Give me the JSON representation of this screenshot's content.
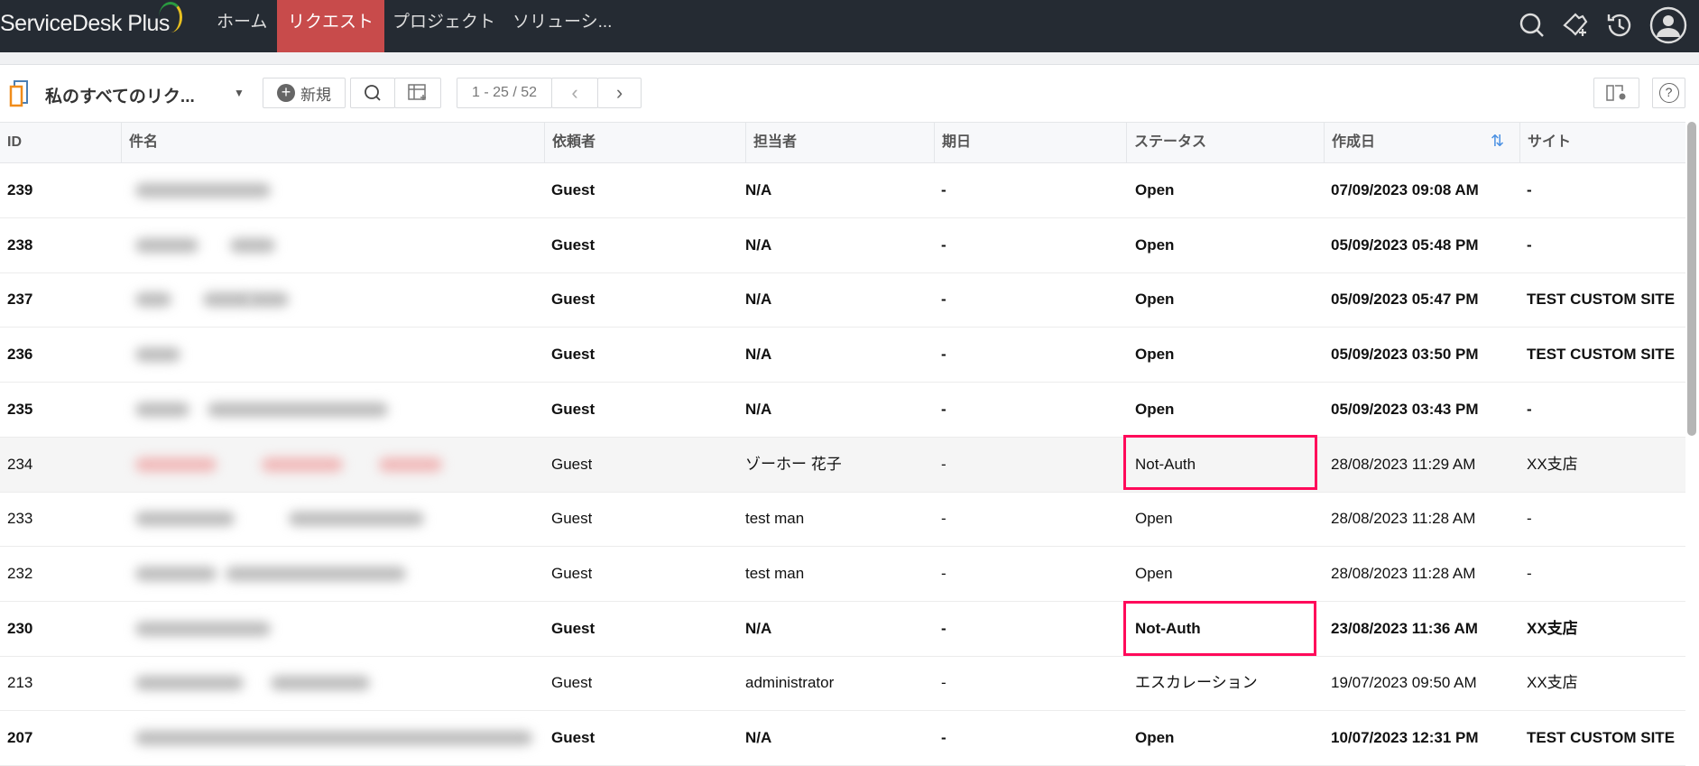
{
  "app": {
    "logo": "ServiceDesk Plus"
  },
  "nav": [
    {
      "label": "ホーム"
    },
    {
      "label": "リクエスト",
      "active": true
    },
    {
      "label": "プロジェクト"
    },
    {
      "label": "ソリューシ..."
    }
  ],
  "toolbar": {
    "view_name": "私のすべてのリク...",
    "new_label": "新規",
    "pagination": "1 - 25 / 52"
  },
  "columns": [
    "ID",
    "件名",
    "依頼者",
    "担当者",
    "期日",
    "ステータス",
    "作成日",
    "サイト"
  ],
  "rows": [
    {
      "id": "239",
      "requester": "Guest",
      "tech": "N/A",
      "due": "-",
      "status": "Open",
      "created": "07/09/2023 09:08 AM",
      "site": "-",
      "bold": true
    },
    {
      "id": "238",
      "requester": "Guest",
      "tech": "N/A",
      "due": "-",
      "status": "Open",
      "created": "05/09/2023 05:48 PM",
      "site": "-",
      "bold": true
    },
    {
      "id": "237",
      "requester": "Guest",
      "tech": "N/A",
      "due": "-",
      "status": "Open",
      "created": "05/09/2023 05:47 PM",
      "site": "TEST CUSTOM SITE",
      "bold": true
    },
    {
      "id": "236",
      "requester": "Guest",
      "tech": "N/A",
      "due": "-",
      "status": "Open",
      "created": "05/09/2023 03:50 PM",
      "site": "TEST CUSTOM SITE",
      "bold": true
    },
    {
      "id": "235",
      "requester": "Guest",
      "tech": "N/A",
      "due": "-",
      "status": "Open",
      "created": "05/09/2023 03:43 PM",
      "site": "-",
      "bold": true
    },
    {
      "id": "234",
      "requester": "Guest",
      "tech": "ゾーホー 花子",
      "due": "-",
      "status": "Not-Auth",
      "created": "28/08/2023 11:29 AM",
      "site": "XX支店",
      "bold": false
    },
    {
      "id": "233",
      "requester": "Guest",
      "tech": "test man",
      "due": "-",
      "status": "Open",
      "created": "28/08/2023 11:28 AM",
      "site": "-",
      "bold": false
    },
    {
      "id": "232",
      "requester": "Guest",
      "tech": "test man",
      "due": "-",
      "status": "Open",
      "created": "28/08/2023 11:28 AM",
      "site": "-",
      "bold": false
    },
    {
      "id": "230",
      "requester": "Guest",
      "tech": "N/A",
      "due": "-",
      "status": "Not-Auth",
      "created": "23/08/2023 11:36 AM",
      "site": "XX支店",
      "bold": true
    },
    {
      "id": "213",
      "requester": "Guest",
      "tech": "administrator",
      "due": "-",
      "status": "エスカレーション",
      "created": "19/07/2023 09:50 AM",
      "site": "XX支店",
      "bold": false
    },
    {
      "id": "207",
      "requester": "Guest",
      "tech": "N/A",
      "due": "-",
      "status": "Open",
      "created": "10/07/2023 12:31 PM",
      "site": "TEST CUSTOM SITE",
      "bold": true
    }
  ],
  "colors": {
    "header_bg": "#252b33",
    "active_nav": "#c84b4b",
    "highlight_box": "#ff0a5a"
  }
}
